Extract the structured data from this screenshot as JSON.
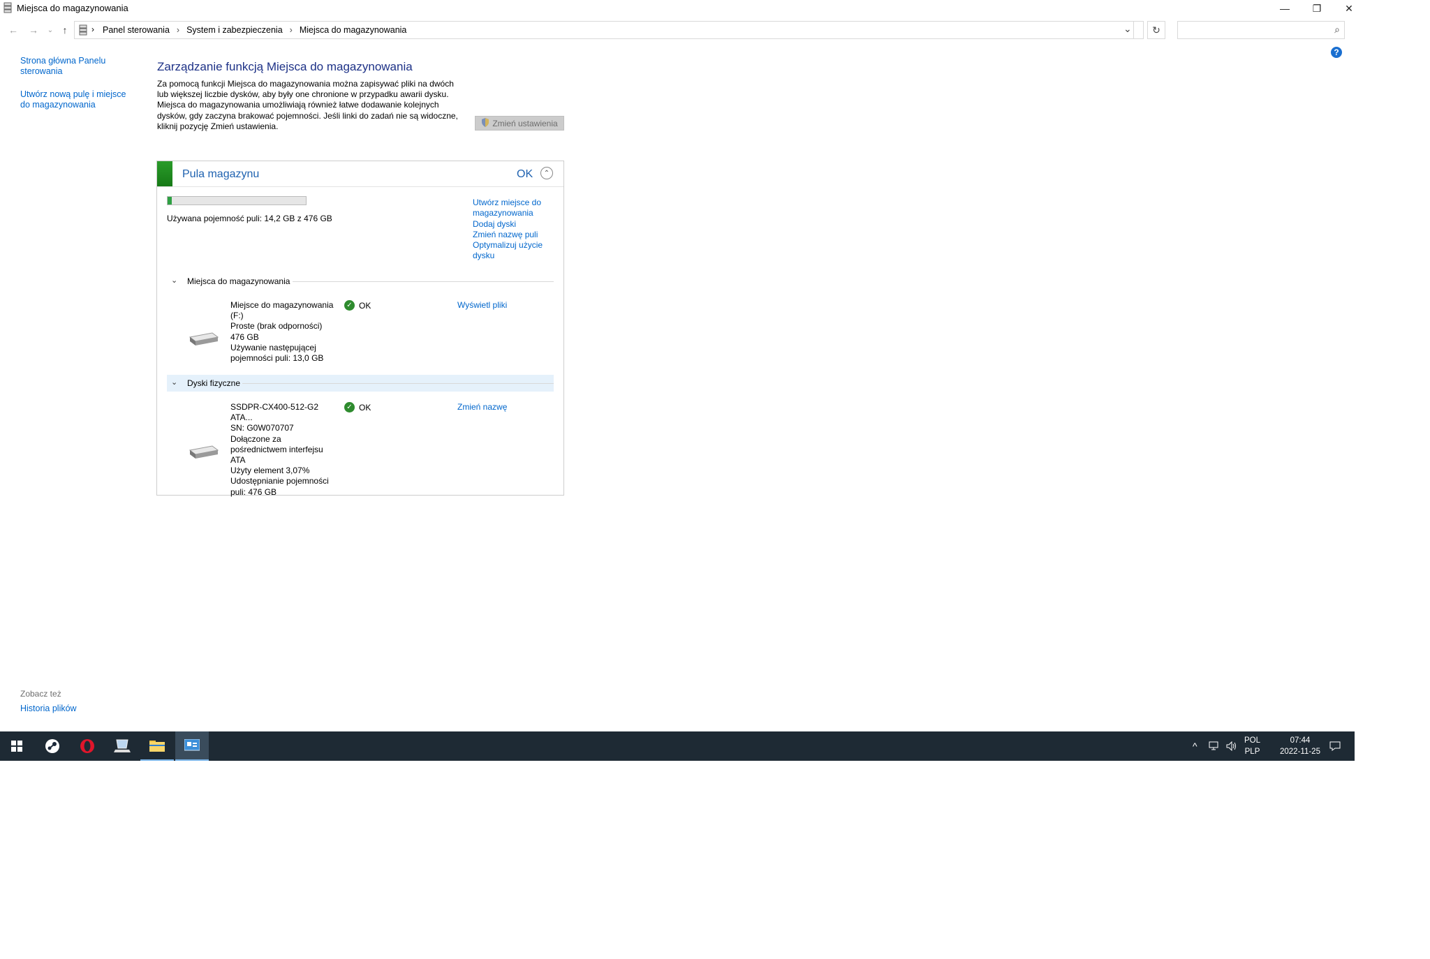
{
  "window": {
    "title": "Miejsca do magazynowania",
    "minimize": "—",
    "restore": "❐",
    "close": "✕"
  },
  "address": {
    "crumbs": [
      "Panel sterowania",
      "System i zabezpieczenia",
      "Miejsca do magazynowania"
    ],
    "separator": "›",
    "dropdown": "⌄",
    "refresh": "↻",
    "search_placeholder": "",
    "search_icon": "⌕"
  },
  "nav": {
    "back": "←",
    "forward": "→",
    "recent": "⌄",
    "up": "↑"
  },
  "sidebar": {
    "home_link": "Strona główna Panelu sterowania",
    "new_pool_link": "Utwórz nową pulę i miejsce do magazynowania",
    "see_also": "Zobacz też",
    "history_link": "Historia plików"
  },
  "main": {
    "heading": "Zarządzanie funkcją Miejsca do magazynowania",
    "intro": "Za pomocą funkcji Miejsca do magazynowania można zapisywać pliki na dwóch lub większej liczbie dysków, aby były one chronione w przypadku awarii dysku. Miejsca do magazynowania umożliwiają również łatwe dodawanie kolejnych dysków, gdy zaczyna brakować pojemności. Jeśli linki do zadań nie są widoczne, kliknij pozycję Zmień ustawienia.",
    "change_settings": "Zmień ustawienia",
    "help": "?"
  },
  "pool": {
    "title": "Pula magazynu",
    "status": "OK",
    "collapse_glyph": "⌃",
    "usage_fraction": 0.03,
    "capacity_text": "Używana pojemność puli: 14,2 GB z 476 GB",
    "links": [
      "Utwórz miejsce do magazynowania",
      "Dodaj dyski",
      "Zmień nazwę puli",
      "Optymalizuj użycie dysku"
    ],
    "spaces_section": "Miejsca do magazynowania",
    "space": {
      "lines": [
        "Miejsce do magazynowania (F:)",
        "Proste (brak odporności)",
        "476 GB",
        "Używanie następującej pojemności puli: 13,0 GB"
      ],
      "status": "OK",
      "link": "Wyświetl pliki"
    },
    "disks_section": "Dyski fizyczne",
    "disk": {
      "lines": [
        "SSDPR-CX400-512-G2 ATA...",
        "SN: G0W070707",
        "Dołączone za pośrednictwem interfejsu ATA",
        "Użyty element 3,07%",
        "Udostępnianie pojemności puli: 476 GB"
      ],
      "status": "OK",
      "link": "Zmień nazwę"
    },
    "check_glyph": "✓",
    "chevron_glyph": "⌄"
  },
  "taskbar": {
    "lang": "POL",
    "layout": "PLP",
    "time": "07:44",
    "date": "2022-11-25",
    "tray_up": "^",
    "notif": "🗨",
    "colors": {
      "bg": "#1e2a34",
      "active": "#3a4c5c"
    }
  }
}
